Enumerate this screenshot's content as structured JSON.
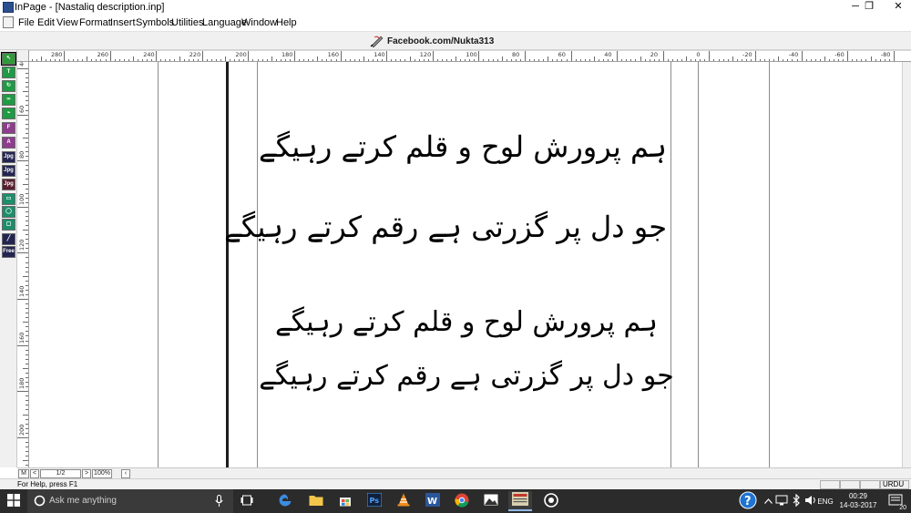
{
  "window": {
    "title": "InPage - [Nastaliq description.inp]",
    "controls": {
      "minimize": "─",
      "maximize": "❐",
      "close": "✕"
    }
  },
  "menu": {
    "items": [
      "File",
      "Edit",
      "View",
      "Format",
      "Insert",
      "Symbols",
      "Utilities",
      "Language",
      "Window",
      "Help"
    ]
  },
  "toolbar": {
    "banner_text": "Facebook.com/Nukta313"
  },
  "palette": {
    "tools": [
      {
        "name": "arrow-tool",
        "label": "↖",
        "color": "sel"
      },
      {
        "name": "text-tool",
        "label": "T",
        "color": "green"
      },
      {
        "name": "rotate-tool",
        "label": "↻",
        "color": "green"
      },
      {
        "name": "link-tool",
        "label": "∞",
        "color": "green"
      },
      {
        "name": "unlink-tool",
        "label": "⌁",
        "color": "green"
      },
      {
        "name": "text-box-tool",
        "label": "F Box",
        "color": "purple"
      },
      {
        "name": "text-box-2-tool",
        "label": "A Box",
        "color": "purple"
      },
      {
        "name": "image-box-tool",
        "label": "Jpg",
        "color": "navy"
      },
      {
        "name": "image-box-2-tool",
        "label": "Jpg",
        "color": "navy"
      },
      {
        "name": "image-box-3-tool",
        "label": "Jpg",
        "color": "maroon"
      },
      {
        "name": "rectangle-tool",
        "label": "▭",
        "color": "teal"
      },
      {
        "name": "ellipse-tool",
        "label": "◯",
        "color": "teal"
      },
      {
        "name": "rounded-rect-tool",
        "label": "▢",
        "color": "teal"
      },
      {
        "name": "line-tool",
        "label": "╱",
        "color": "navy"
      },
      {
        "name": "free-draw-tool",
        "label": "Free",
        "color": "navy"
      }
    ]
  },
  "ruler": {
    "top_labels": [
      "280",
      "260",
      "240",
      "220",
      "200",
      "180",
      "160",
      "140",
      "120",
      "100",
      "80",
      "60",
      "40",
      "20",
      "0",
      "-20",
      "-40",
      "-60",
      "-80"
    ],
    "left_labels": [
      "40",
      "60",
      "80",
      "100",
      "120",
      "140",
      "160",
      "180",
      "200",
      "220"
    ]
  },
  "document": {
    "nastaliq_line1": "ہم پرورش لوح و قلم کرتے رہیگے",
    "nastaliq_line2": "جو دل پر گزرتی ہے رقم کرتے رہیگے",
    "naskh_line1": "ہم پرورش لوح و قلم کرتے رہیگے",
    "naskh_line2": "جو دل پر گزرتی ہے رقم کرتے رہیگے"
  },
  "navigation": {
    "master_label": "M",
    "prev_label": "<",
    "page_indicator": "1/2",
    "next_label": ">",
    "zoom": "100%",
    "scroll_left": "‹"
  },
  "status": {
    "help_text": "For Help, press F1",
    "language": "URDU"
  },
  "taskbar": {
    "search_placeholder": "Ask me anything",
    "clock_time": "00:29",
    "clock_date": "14-03-2017",
    "language_indicator": "ENG",
    "notification_count": "20"
  }
}
